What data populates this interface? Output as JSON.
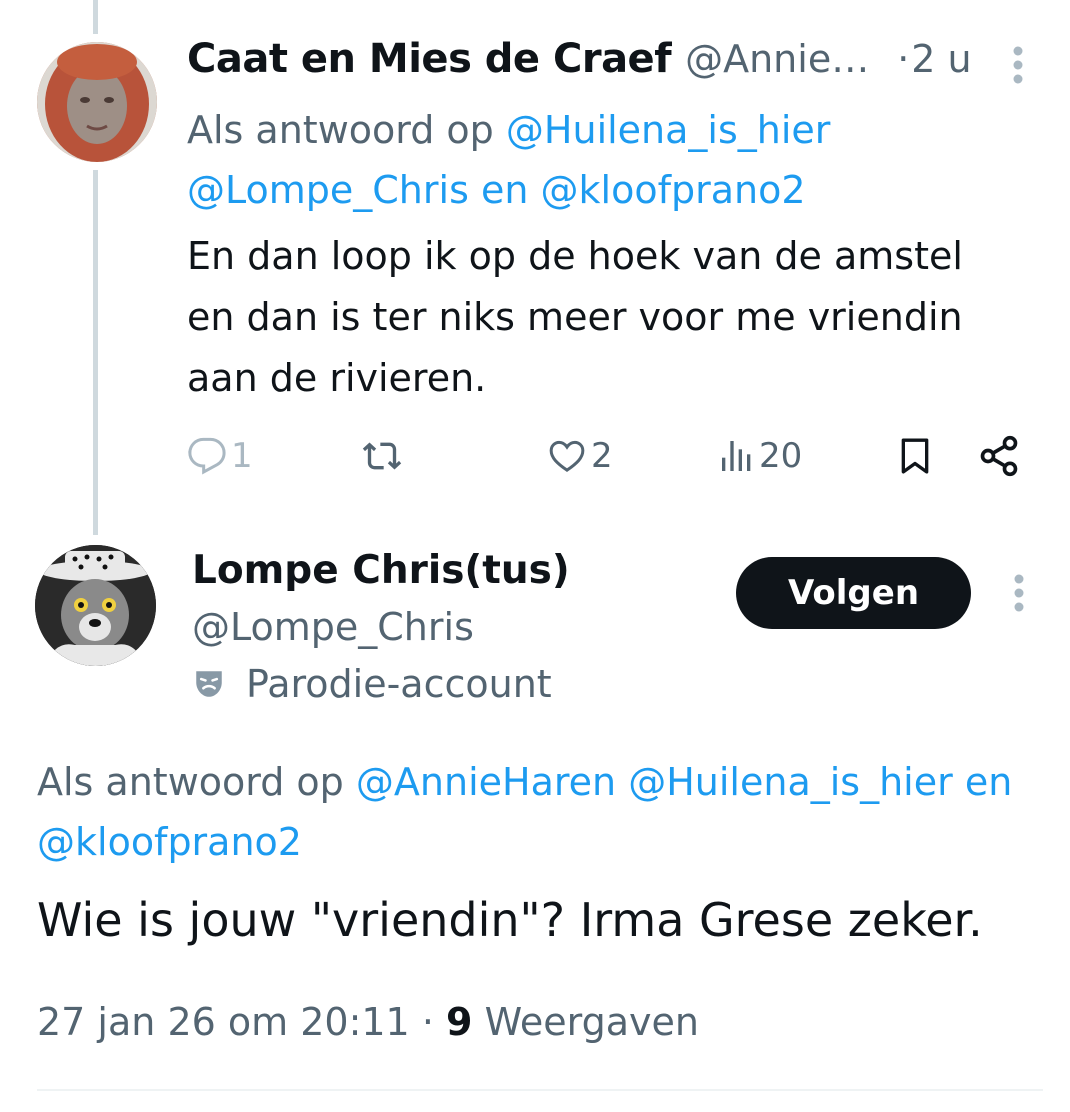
{
  "tweet1": {
    "name": "Caat en Mies de Craef",
    "handle": "@Annie…",
    "separator": "·",
    "time": "2 u",
    "reply_prefix": "Als antwoord op",
    "reply_mention_1": "@Huilena_is_hier",
    "reply_mention_2": "@Lompe_Chris",
    "reply_and": "en",
    "reply_mention_3": "@kloofprano2",
    "text_line_1": "En dan loop ik op de hoek van de amstel",
    "text_line_2": "en dan is ter niks meer voor me vriendin",
    "text_line_3": "aan de rivieren.",
    "actions": {
      "reply_count": "1",
      "like_count": "2",
      "views_count": "20"
    }
  },
  "tweet2": {
    "name": "Lompe Chris(tus)",
    "handle": "@Lompe_Chris",
    "parody_label": "Parodie-account",
    "follow_label": "Volgen",
    "reply_prefix": "Als antwoord op",
    "reply_mention_1": "@AnnieHaren",
    "reply_mention_2": "@Huilena_is_hier",
    "reply_and": "en",
    "reply_mention_3": "@kloofprano2",
    "text": "Wie is jouw \"vriendin\"? Irma Grese zeker.",
    "timestamp": "27 jan 26 om 20:11",
    "meta_separator": "·",
    "views_count": "9",
    "views_label": "Weergaven"
  },
  "colors": {
    "link": "#1d9bf0",
    "muted": "#536471",
    "text": "#0f1419",
    "thread_line": "#cfd9de"
  },
  "icons": [
    "more-vertical-icon",
    "reply-icon",
    "retweet-icon",
    "like-icon",
    "views-icon",
    "bookmark-icon",
    "share-icon",
    "parody-mask-icon"
  ]
}
